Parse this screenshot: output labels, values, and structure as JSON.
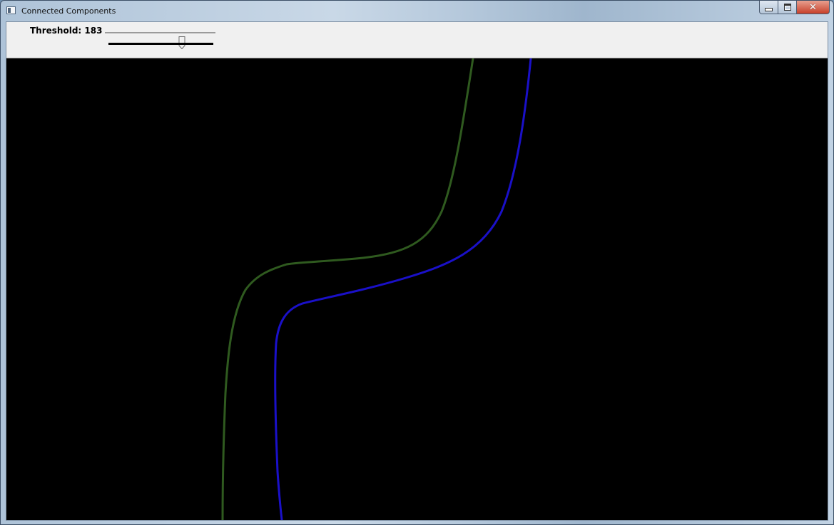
{
  "window": {
    "title": "Connected Components",
    "icon": "window-app-icon",
    "buttons": [
      "minimize",
      "maximize",
      "close"
    ]
  },
  "trackbar": {
    "label": "Threshold: 183",
    "value": 183,
    "min": 0,
    "max": 255
  },
  "canvas": {
    "background": "#000000",
    "contours": [
      {
        "name": "green-contour",
        "color": "#2f5a1f"
      },
      {
        "name": "blue-contour",
        "color": "#1a10c8"
      }
    ]
  }
}
